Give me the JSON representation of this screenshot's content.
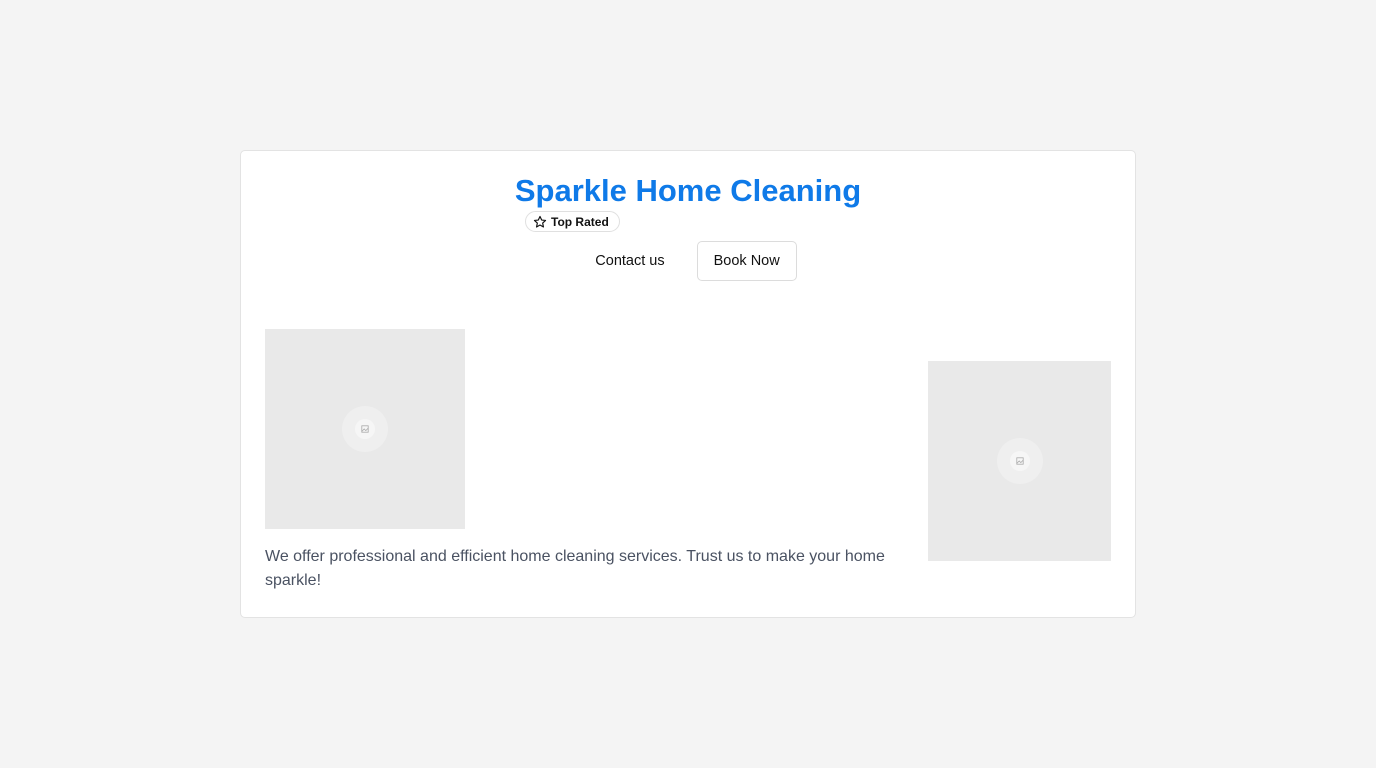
{
  "header": {
    "title": "Sparkle Home Cleaning",
    "badge_label": "Top Rated",
    "badge_icon": "star-icon"
  },
  "actions": {
    "contact_label": "Contact us",
    "book_label": "Book Now"
  },
  "content": {
    "description": "We offer professional and efficient home cleaning services. Trust us to make your home sparkle!",
    "images": [
      "image-placeholder-icon",
      "image-placeholder-icon"
    ]
  },
  "colors": {
    "title": "#0f7ae8",
    "background": "#f4f4f4",
    "card": "#ffffff",
    "description": "#4a5262"
  }
}
